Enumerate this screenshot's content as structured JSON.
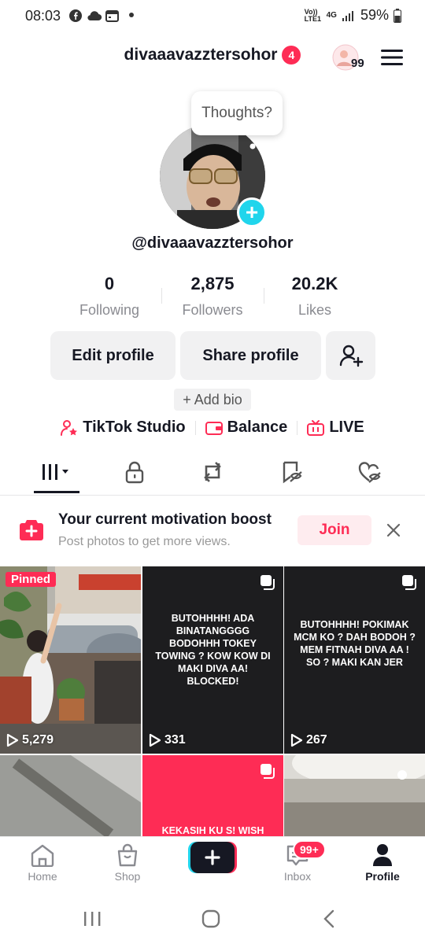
{
  "status_bar": {
    "time": "08:03",
    "battery": "59%",
    "network": "4G",
    "volte": "Vo)) LTE1"
  },
  "header": {
    "username": "divaaavazztersohor",
    "notif_count": "4",
    "avatar_badge_count": "99"
  },
  "profile": {
    "thought_bubble": "Thoughts?",
    "handle": "@divaaavazztersohor",
    "stats": [
      {
        "value": "0",
        "label": "Following"
      },
      {
        "value": "2,875",
        "label": "Followers"
      },
      {
        "value": "20.2K",
        "label": "Likes"
      }
    ],
    "edit_profile": "Edit profile",
    "share_profile": "Share profile",
    "add_bio": "+ Add bio",
    "links": {
      "studio": "TikTok Studio",
      "balance": "Balance",
      "live": "LIVE"
    }
  },
  "motivation": {
    "title": "Your current motivation boost",
    "subtitle": "Post photos to get more views.",
    "join": "Join"
  },
  "grid": {
    "pinned_label": "Pinned",
    "videos": [
      {
        "views": "5,279"
      },
      {
        "views": "331",
        "caption": "BUTOHHHH! ADA BINATANGGGG BODOHHH TOKEY TOWING ? KOW KOW DI MAKI DIVA AA! BLOCKED!"
      },
      {
        "views": "267",
        "caption": "BUTOHHHH! POKIMAK MCM KO ? DAH BODOH ? MEM FITNAH DIVA AA ! SO ? MAKI KAN JER"
      },
      {},
      {
        "caption": "KEKASIH KU S! WISH"
      },
      {}
    ]
  },
  "bottom_nav": {
    "home": "Home",
    "shop": "Shop",
    "inbox": "Inbox",
    "inbox_badge": "99+",
    "profile": "Profile"
  },
  "colors": {
    "accent": "#fe2c55",
    "cyan": "#20d5ec",
    "text": "#161823",
    "muted": "#8a8b91"
  }
}
